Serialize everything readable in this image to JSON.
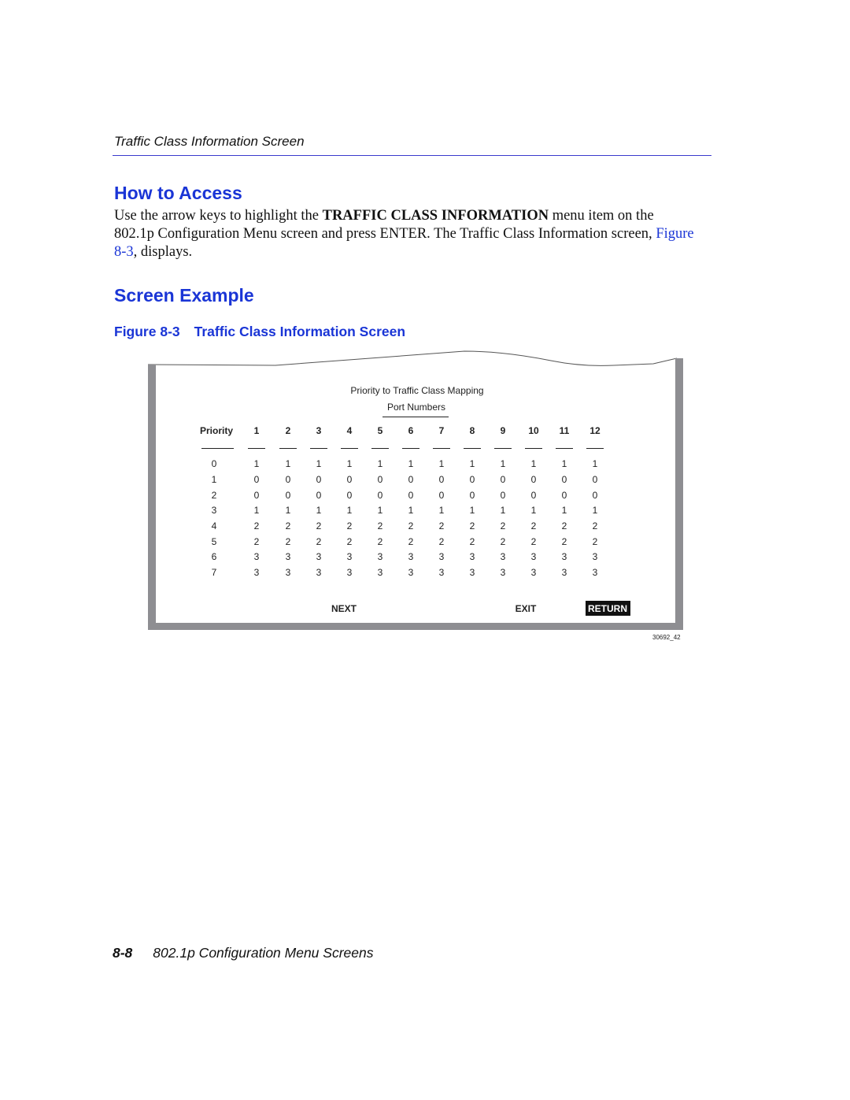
{
  "header": {
    "running_title": "Traffic Class Information Screen"
  },
  "section1": {
    "title": "How to Access",
    "text_before": "Use the arrow keys to highlight the ",
    "bold": "TRAFFIC CLASS INFORMATION",
    "text_mid": " menu item on the 802.1p Configuration Menu screen and press ENTER. The Traffic Class Information screen, ",
    "link": "Figure 8-3",
    "text_after": ", displays."
  },
  "section2": {
    "title": "Screen Example"
  },
  "figure": {
    "number": "Figure 8-3",
    "title": "Traffic Class Information Screen",
    "art_id": "30692_42"
  },
  "screen": {
    "title": "Priority to Traffic Class Mapping",
    "subtitle": "Port Numbers",
    "priority_header": "Priority",
    "ports": [
      "1",
      "2",
      "3",
      "4",
      "5",
      "6",
      "7",
      "8",
      "9",
      "10",
      "11",
      "12"
    ],
    "rows": [
      {
        "priority": "0",
        "values": [
          "1",
          "1",
          "1",
          "1",
          "1",
          "1",
          "1",
          "1",
          "1",
          "1",
          "1",
          "1"
        ]
      },
      {
        "priority": "1",
        "values": [
          "0",
          "0",
          "0",
          "0",
          "0",
          "0",
          "0",
          "0",
          "0",
          "0",
          "0",
          "0"
        ]
      },
      {
        "priority": "2",
        "values": [
          "0",
          "0",
          "0",
          "0",
          "0",
          "0",
          "0",
          "0",
          "0",
          "0",
          "0",
          "0"
        ]
      },
      {
        "priority": "3",
        "values": [
          "1",
          "1",
          "1",
          "1",
          "1",
          "1",
          "1",
          "1",
          "1",
          "1",
          "1",
          "1"
        ]
      },
      {
        "priority": "4",
        "values": [
          "2",
          "2",
          "2",
          "2",
          "2",
          "2",
          "2",
          "2",
          "2",
          "2",
          "2",
          "2"
        ]
      },
      {
        "priority": "5",
        "values": [
          "2",
          "2",
          "2",
          "2",
          "2",
          "2",
          "2",
          "2",
          "2",
          "2",
          "2",
          "2"
        ]
      },
      {
        "priority": "6",
        "values": [
          "3",
          "3",
          "3",
          "3",
          "3",
          "3",
          "3",
          "3",
          "3",
          "3",
          "3",
          "3"
        ]
      },
      {
        "priority": "7",
        "values": [
          "3",
          "3",
          "3",
          "3",
          "3",
          "3",
          "3",
          "3",
          "3",
          "3",
          "3",
          "3"
        ]
      }
    ],
    "commands": {
      "next": "NEXT",
      "exit": "EXIT",
      "return": "RETURN"
    }
  },
  "footer": {
    "page_number": "8-8",
    "chapter": "802.1p Configuration Menu Screens"
  }
}
